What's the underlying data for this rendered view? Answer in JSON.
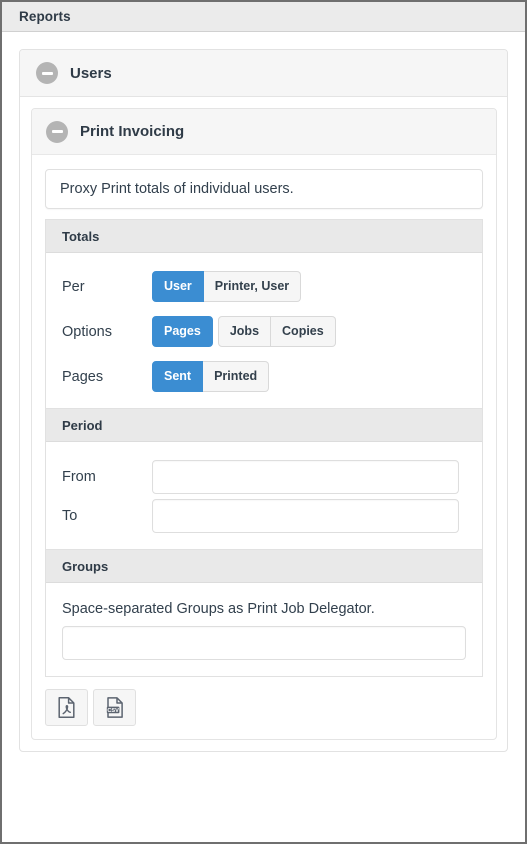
{
  "header": {
    "title": "Reports"
  },
  "panels": {
    "outer": {
      "title": "Users",
      "collapse_icon": "circle-minus-icon"
    },
    "inner": {
      "title": "Print Invoicing",
      "collapse_icon": "circle-minus-icon"
    }
  },
  "description": "Proxy Print totals of individual users.",
  "sections": {
    "totals": {
      "title": "Totals",
      "rows": [
        {
          "label": "Per",
          "groups": [
            {
              "options": [
                {
                  "label": "User",
                  "active": true
                },
                {
                  "label": "Printer, User",
                  "active": false
                }
              ]
            }
          ]
        },
        {
          "label": "Options",
          "groups": [
            {
              "options": [
                {
                  "label": "Pages",
                  "active": true
                }
              ]
            },
            {
              "options": [
                {
                  "label": "Jobs",
                  "active": false
                },
                {
                  "label": "Copies",
                  "active": false
                }
              ]
            }
          ]
        },
        {
          "label": "Pages",
          "groups": [
            {
              "options": [
                {
                  "label": "Sent",
                  "active": true
                },
                {
                  "label": "Printed",
                  "active": false
                }
              ]
            }
          ]
        }
      ]
    },
    "period": {
      "title": "Period",
      "from_label": "From",
      "from_value": "",
      "from_placeholder": "",
      "to_label": "To",
      "to_value": "",
      "to_placeholder": ""
    },
    "groups": {
      "title": "Groups",
      "note": "Space-separated Groups as Print Job Delegator.",
      "value": "",
      "placeholder": ""
    }
  },
  "export": {
    "pdf_label": "pdf-export",
    "csv_label": "csv-export",
    "csv_badge": "CSV"
  },
  "colors": {
    "accent": "#3b8dd2",
    "header_bg": "#ebebeb",
    "section_header_bg": "#e9e9e9",
    "panel_header_bg": "#f6f6f6",
    "text": "#32404d",
    "icon_gray": "#b4b4b4"
  }
}
